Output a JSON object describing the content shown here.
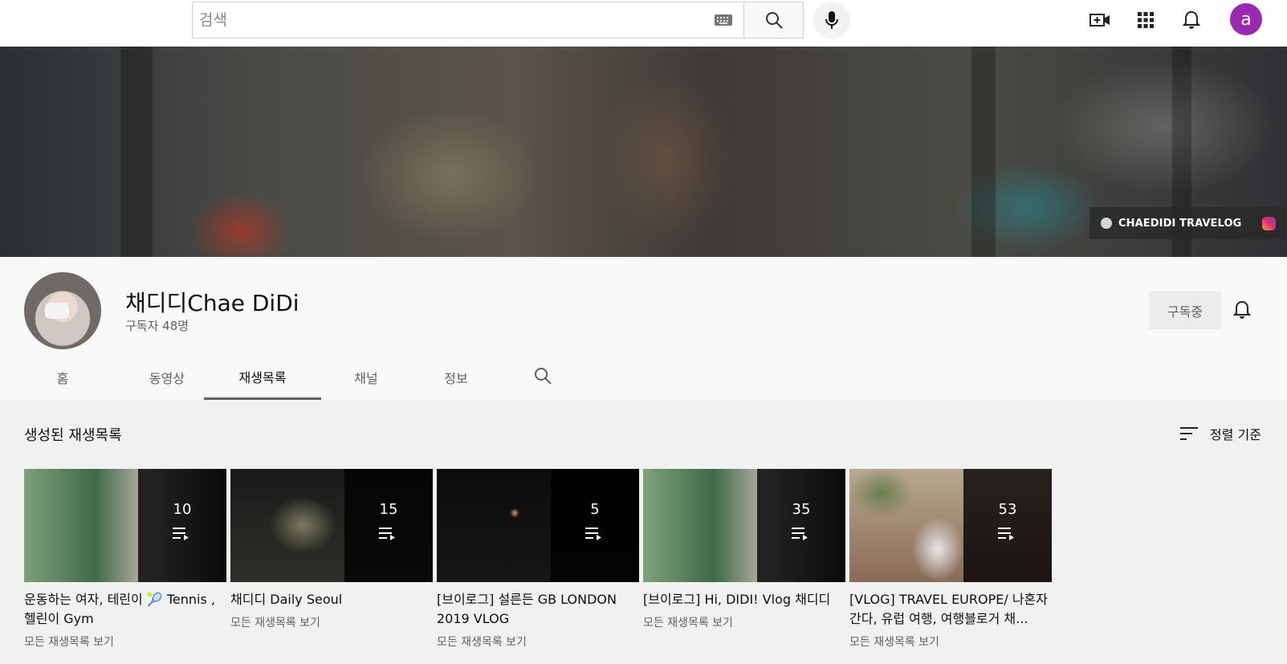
{
  "topbar": {
    "search_placeholder": "검색",
    "avatar_letter": "a",
    "avatar_color": "#9c27b0",
    "icons": [
      "keyboard-icon",
      "search-icon",
      "mic-icon",
      "create-video-icon",
      "apps-grid-icon",
      "notifications-bell-icon"
    ]
  },
  "banner": {
    "link_label": "CHAEDIDI TRAVELOG"
  },
  "channel": {
    "name": "채디디Chae DiDi",
    "subscribers": "구독자 48명",
    "subscribed_label": "구독중"
  },
  "tabs": [
    {
      "label": "홈"
    },
    {
      "label": "동영상"
    },
    {
      "label": "재생목록",
      "active": true
    },
    {
      "label": "채널"
    },
    {
      "label": "정보"
    }
  ],
  "section": {
    "title": "생성된 재생목록",
    "sort_label": "정렬 기준"
  },
  "playlists": [
    {
      "count": "10",
      "title": "운동하는 여자, 테린이 🎾 Tennis , 헬린이 Gym",
      "link": "모든 재생목록 보기",
      "thumb": "green-fence"
    },
    {
      "count": "15",
      "title": "채디디 Daily Seoul",
      "link": "모든 재생목록 보기",
      "thumb": "night-trees"
    },
    {
      "count": "5",
      "title": "[브이로그] 설른든 GB LONDON 2019 VLOG",
      "link": "모든 재생목록 보기",
      "thumb": "dark-night"
    },
    {
      "count": "35",
      "title": "[브이로그] Hi, DIDI! Vlog 채디디",
      "link": "모든 재생목록 보기",
      "thumb": "green-fence"
    },
    {
      "count": "53",
      "title": "[VLOG] TRAVEL EUROPE/ 나혼자 간다, 유럽 여행, 여행블로거 채...",
      "link": "모든 재생목록 보기",
      "thumb": "europe-cafe"
    }
  ]
}
